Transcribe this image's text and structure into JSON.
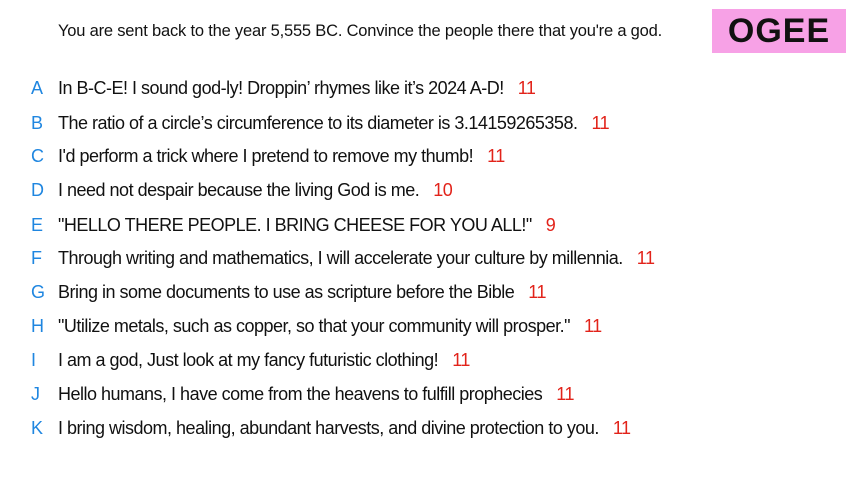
{
  "prompt": "You are sent back to the year 5,555 BC. Convince the people there that you're a god.",
  "badge": {
    "label": "OGEE",
    "color": "#f7a1e6"
  },
  "colors": {
    "letter": "#1f86e0",
    "score": "#e2231a",
    "text": "#111111"
  },
  "answers": [
    {
      "letter": "A",
      "text": "In B-C-E!  I sound god-ly!  Droppin’ rhymes like it’s 2024 A-D!",
      "score": "11"
    },
    {
      "letter": "B",
      "text": "The ratio of a circle’s circumference to its diameter is 3.14159265358.",
      "score": "11"
    },
    {
      "letter": "C",
      "text": "I'd perform a trick where I pretend to remove my thumb!",
      "score": "11"
    },
    {
      "letter": "D",
      "text": "I need not despair because the living God is me.",
      "score": "10"
    },
    {
      "letter": "E",
      "text": "\"HELLO THERE PEOPLE. I BRING CHEESE FOR YOU ALL!\"",
      "score": "9"
    },
    {
      "letter": "F",
      "text": "Through writing and mathematics, I will accelerate your culture by millennia.",
      "score": "11"
    },
    {
      "letter": "G",
      "text": "Bring in some documents to use as scripture before the Bible",
      "score": "11"
    },
    {
      "letter": "H",
      "text": "\"Utilize metals, such as copper, so that your community will prosper.\"",
      "score": "11"
    },
    {
      "letter": "I",
      "text": "I am a god, Just look at my fancy futuristic clothing!",
      "score": "11"
    },
    {
      "letter": "J",
      "text": "Hello humans, I have come from the heavens to fulfill prophecies",
      "score": "11"
    },
    {
      "letter": "K",
      "text": "I bring wisdom, healing, abundant harvests, and divine protection to you.",
      "score": "11"
    }
  ]
}
